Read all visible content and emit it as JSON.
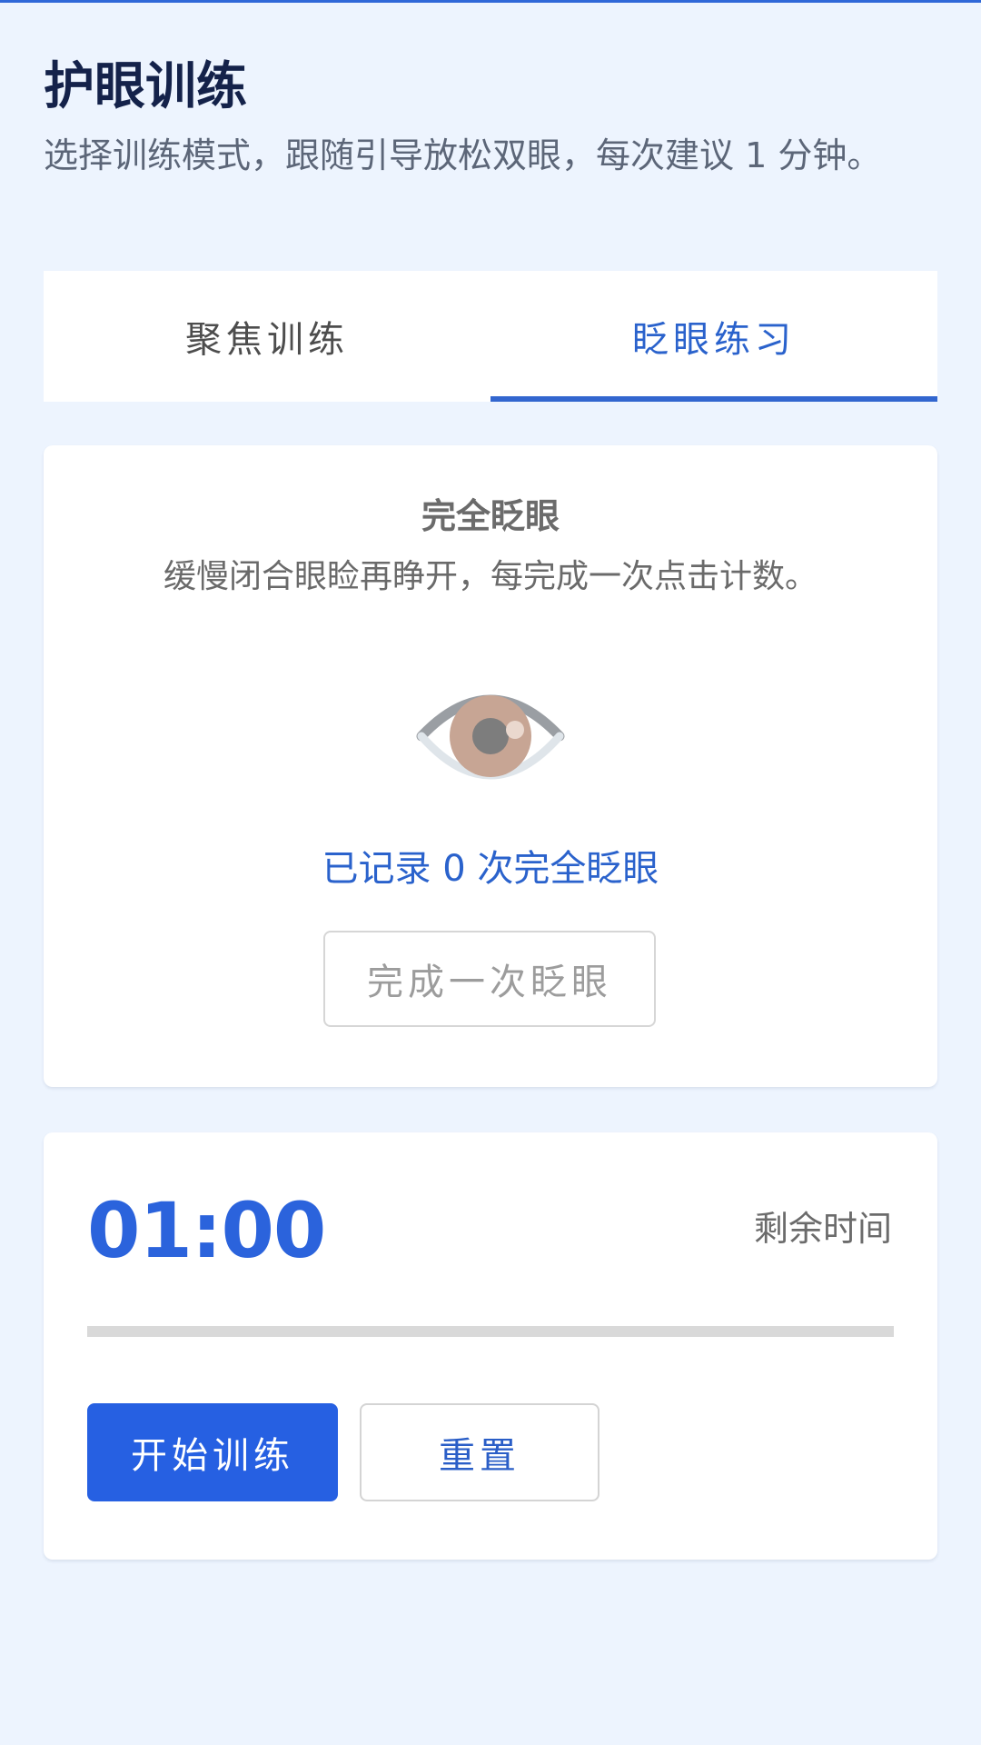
{
  "header": {
    "title": "护眼训练",
    "subtitle": "选择训练模式，跟随引导放松双眼，每次建议 1 分钟。"
  },
  "tabs": [
    {
      "label": "聚焦训练",
      "active": false
    },
    {
      "label": "眨眼练习",
      "active": true
    }
  ],
  "blink_card": {
    "title": "完全眨眼",
    "description": "缓慢闭合眼睑再睁开，每完成一次点击计数。",
    "count_text": "已记录 0 次完全眨眼",
    "button_label": "完成一次眨眼",
    "eye_icon": "eye-icon"
  },
  "timer": {
    "value": "01:00",
    "label": "剩余时间",
    "progress": 0,
    "start_label": "开始训练",
    "reset_label": "重置"
  },
  "colors": {
    "accent": "#2660e2",
    "background": "#edf4fe",
    "tab_active": "#2a62cc"
  }
}
